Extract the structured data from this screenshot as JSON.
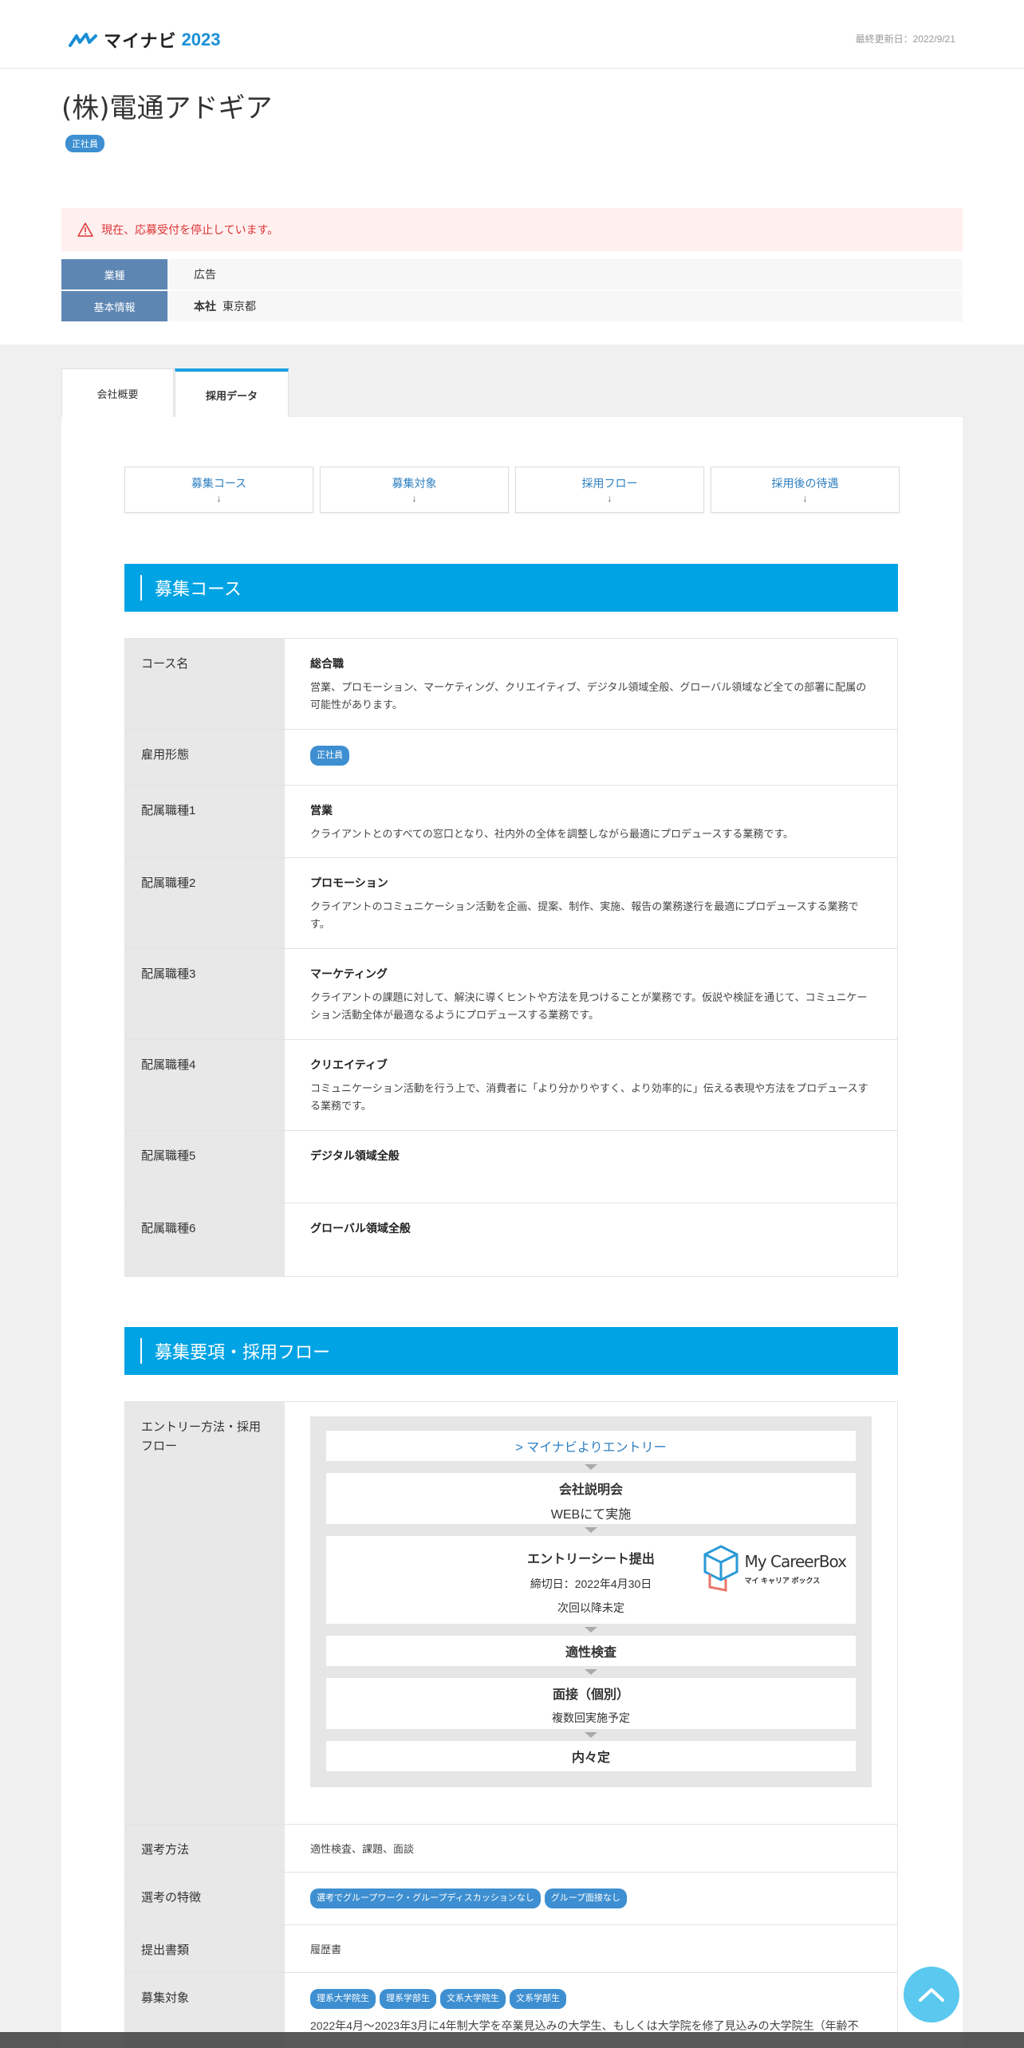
{
  "header": {
    "logo_text": "マイナビ",
    "logo_year": "2023",
    "updated": "最終更新日：2022/9/21"
  },
  "company": {
    "name": "(株)電通アドギア",
    "employment_badge": "正社員"
  },
  "alert": {
    "message": "現在、応募受付を停止しています。"
  },
  "info": {
    "industry_label": "業種",
    "industry_value": "広告",
    "basic_label": "基本情報",
    "hq_label": "本社",
    "hq_value": "東京都"
  },
  "tabs": {
    "overview": "会社概要",
    "recruit": "採用データ"
  },
  "anchors": [
    {
      "label": "募集コース",
      "arrow": "↓"
    },
    {
      "label": "募集対象",
      "arrow": "↓"
    },
    {
      "label": "採用フロー",
      "arrow": "↓"
    },
    {
      "label": "採用後の待遇",
      "arrow": "↓"
    }
  ],
  "course_section": {
    "heading": "募集コース",
    "rows": {
      "course_name": {
        "th": "コース名",
        "title": "総合職",
        "desc": "営業、プロモーション、マーケティング、クリエイティブ、デジタル領域全般、グローバル領域など全ての部署に配属の可能性があります。"
      },
      "employment": {
        "th": "雇用形態",
        "chip": "正社員"
      },
      "job1": {
        "th": "配属職種1",
        "title": "営業",
        "desc": "クライアントとのすべての窓口となり、社内外の全体を調整しながら最適にプロデュースする業務です。"
      },
      "job2": {
        "th": "配属職種2",
        "title": "プロモーション",
        "desc": "クライアントのコミュニケーション活動を企画、提案、制作、実施、報告の業務遂行を最適にプロデュースする業務です。"
      },
      "job3": {
        "th": "配属職種3",
        "title": "マーケティング",
        "desc": "クライアントの課題に対して、解決に導くヒントや方法を見つけることが業務です。仮説や検証を通じて、コミュニケーション活動全体が最適なるようにプロデュースする業務です。"
      },
      "job4": {
        "th": "配属職種4",
        "title": "クリエイティブ",
        "desc": "コミュニケーション活動を行う上で、消費者に「より分かりやすく、より効率的に」伝える表現や方法をプロデュースする業務です。"
      },
      "job5": {
        "th": "配属職種5",
        "title": "デジタル領域全般"
      },
      "job6": {
        "th": "配属職種6",
        "title": "グローバル領域全般"
      }
    }
  },
  "flow_section": {
    "heading": "募集要項・採用フロー",
    "entry_th": "エントリー方法・採用フロー",
    "entry_link": "> マイナビよりエントリー",
    "steps": {
      "seminar_title": "会社説明会",
      "seminar_sub": "WEBにて実施",
      "es_title": "エントリーシート提出",
      "es_deadline": "締切日：2022年4月30日",
      "es_next": "次回以降未定",
      "aptitude": "適性検査",
      "interview_title": "面接（個別）",
      "interview_sub": "複数回実施予定",
      "offer": "内々定"
    },
    "mycareerbox": {
      "title": "My CareerBox",
      "sub": "マイ キャリア ボックス"
    },
    "selection_method_th": "選考方法",
    "selection_method": "適性検査、課題、面談",
    "selection_feature_th": "選考の特徴",
    "selection_features": [
      "選考でグループワーク・グループディスカッションなし",
      "グループ面接なし"
    ],
    "documents_th": "提出書類",
    "documents": "履歴書",
    "target_th": "募集対象",
    "targets": [
      "理系大学院生",
      "理系学部生",
      "文系大学院生",
      "文系学部生"
    ],
    "target_desc": "2022年4月～2023年3月に4年制大学を卒業見込みの大学生、もしくは大学院を修了見込みの大学院生（年齢不"
  },
  "colors": {
    "accent": "#00a3e4",
    "badge": "#3d8fd1",
    "th_blue": "#5d86b3",
    "alert_bg": "#fff0f0",
    "alert_text": "#dd3333"
  }
}
